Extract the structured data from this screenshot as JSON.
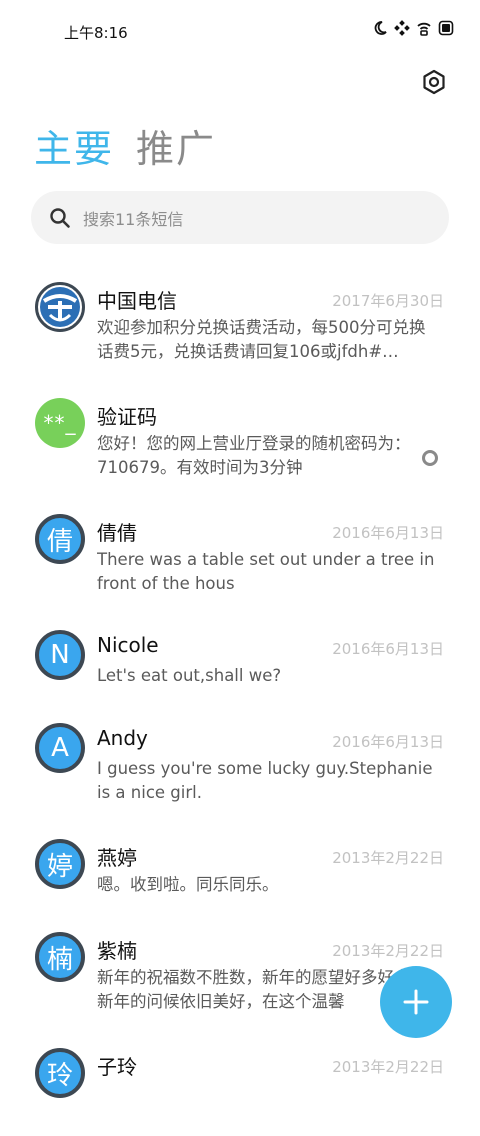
{
  "status": {
    "time": "上午8:16"
  },
  "tabs": {
    "primary": "主要",
    "promo": "推广"
  },
  "search": {
    "placeholder": "搜索11条短信"
  },
  "conversations": [
    {
      "name": "中国电信",
      "date": "2017年6月30日",
      "preview": "欢迎参加积分兑换话费活动，每500分可兑换话费5元，兑换话费请回复106或jfdh#…",
      "avatar": "telecom-logo"
    },
    {
      "name": "验证码",
      "date": "",
      "preview": "您好！您的网上营业厅登录的随机密码为：710679。有效时间为3分钟",
      "avatar_text": "**_"
    },
    {
      "name": "倩倩",
      "date": "2016年6月13日",
      "preview": "There was a table set out under a tree in front of the hous",
      "avatar_text": "倩"
    },
    {
      "name": "Nicole",
      "date": "2016年6月13日",
      "preview": "Let's eat out,shall we?",
      "avatar_text": "N"
    },
    {
      "name": "Andy",
      "date": "2016年6月13日",
      "preview": "I guess you're some lucky guy.Stephanie is a nice girl.",
      "avatar_text": "A"
    },
    {
      "name": "燕婷",
      "date": "2013年2月22日",
      "preview": "嗯。收到啦。同乐同乐。",
      "avatar_text": "婷"
    },
    {
      "name": "紫楠",
      "date": "2013年2月22日",
      "preview": "新年的祝福数不胜数，新年的愿望好多好多，新年的问候依旧美好，在这个温馨",
      "avatar_text": "楠"
    },
    {
      "name": "子玲",
      "date": "2013年2月22日",
      "preview": "",
      "avatar_text": "玲"
    }
  ],
  "colors": {
    "accent": "#3fb6ea",
    "avatar_blue": "#3aa6ee",
    "avatar_green": "#78d05a"
  }
}
